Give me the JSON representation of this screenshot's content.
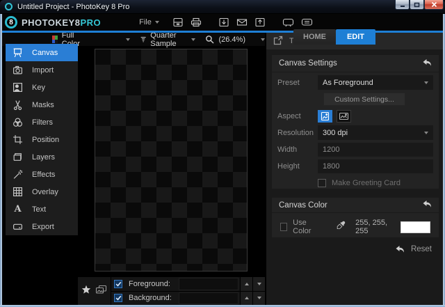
{
  "window": {
    "title": "Untitled Project - PhotoKey 8 Pro"
  },
  "menubar": {
    "logo_glyph": "8",
    "brand_left": "PHOTOKEY8",
    "brand_right": "PRO",
    "file_label": "File",
    "tabs": {
      "home": "HOME",
      "edit": "EDIT"
    }
  },
  "viewbar": {
    "color_mode": "Full Color",
    "sample_mode": "Quarter Sample",
    "zoom_level": "(26.4%)"
  },
  "sidebar": {
    "items": [
      {
        "label": "Canvas"
      },
      {
        "label": "Import"
      },
      {
        "label": "Key"
      },
      {
        "label": "Masks"
      },
      {
        "label": "Filters"
      },
      {
        "label": "Position"
      },
      {
        "label": "Layers"
      },
      {
        "label": "Effects"
      },
      {
        "label": "Overlay"
      },
      {
        "label": "Text",
        "glyph": "A"
      },
      {
        "label": "Export"
      }
    ]
  },
  "toolbox": {
    "title": "TOOLBOX",
    "canvas_settings": {
      "title": "Canvas Settings",
      "preset_label": "Preset",
      "preset_value": "As Foreground",
      "custom_settings_label": "Custom Settings...",
      "aspect_label": "Aspect",
      "resolution_label": "Resolution",
      "resolution_value": "300 dpi",
      "width_label": "Width",
      "width_value": "1200",
      "height_label": "Height",
      "height_value": "1800",
      "greeting_card_label": "Make Greeting Card"
    },
    "canvas_color": {
      "title": "Canvas Color",
      "use_color_label": "Use Color",
      "rgb_value": "255, 255, 255",
      "swatch_color": "#ffffff",
      "swatch_style": "background:#ffffff"
    },
    "reset_label": "Reset"
  },
  "layers_bar": {
    "foreground_label": "Foreground:",
    "background_label": "Background:"
  },
  "colors": {
    "accent_blue": "#1e7fd5",
    "brand_teal": "#2fc4d4",
    "swatch_white": "#ffffff"
  }
}
